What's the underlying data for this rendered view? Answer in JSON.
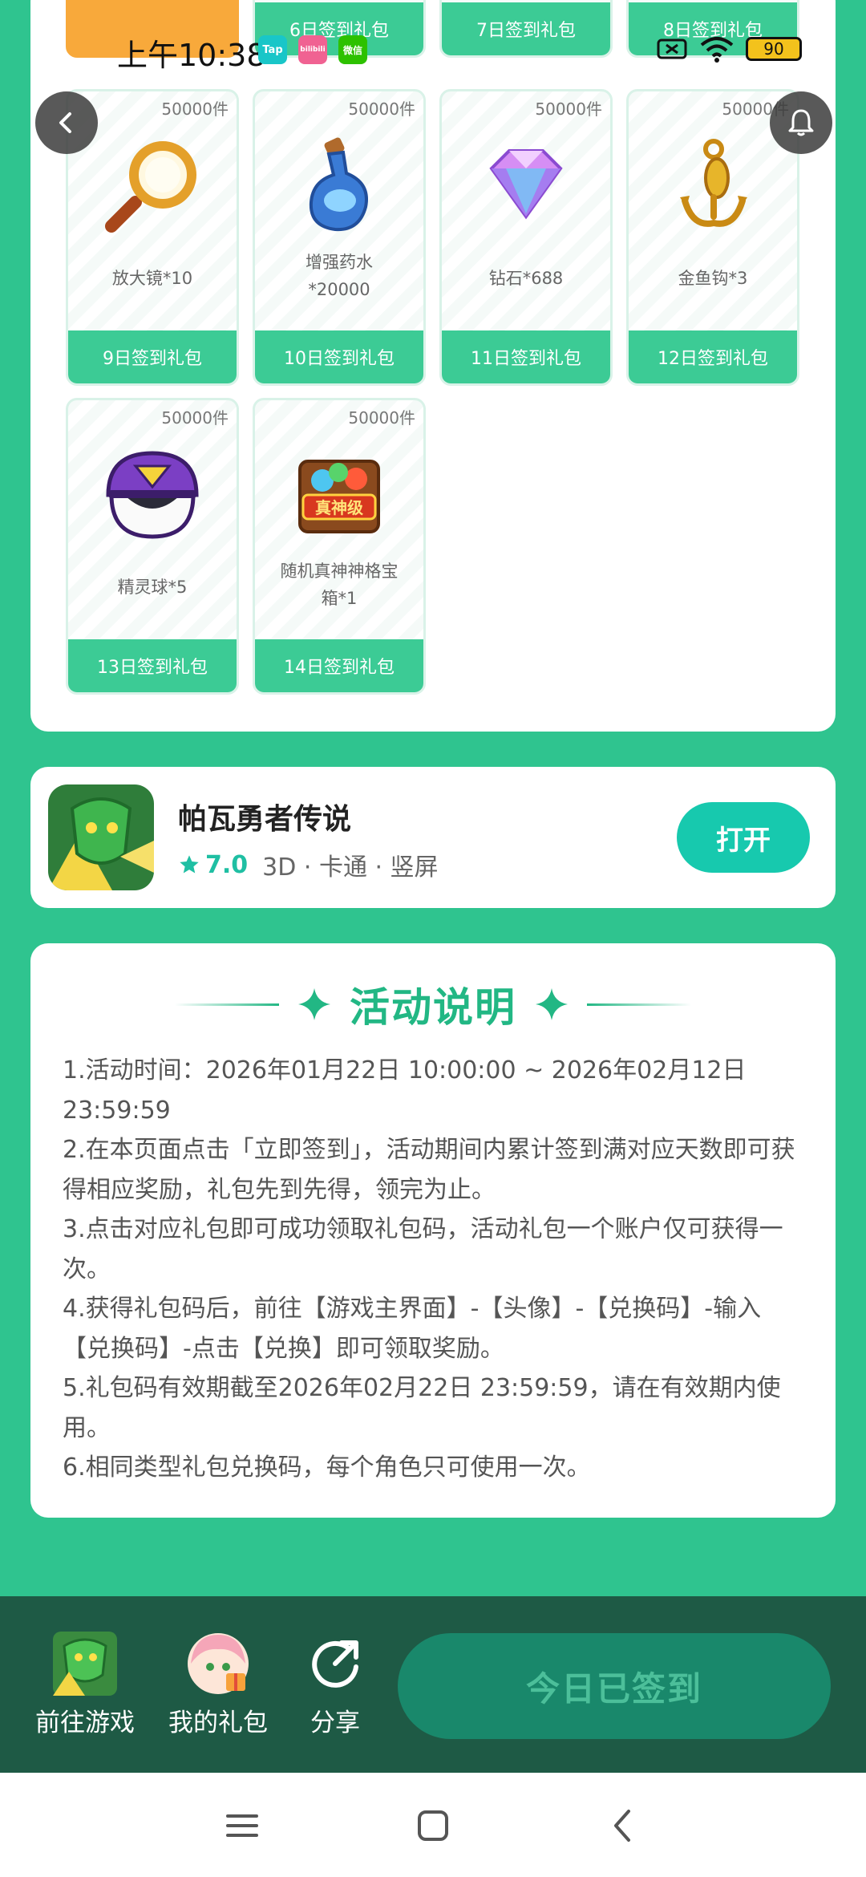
{
  "status_bar": {
    "time": "上午10:38",
    "apps": [
      "Tap",
      "bilibili",
      "微信"
    ],
    "battery": "90"
  },
  "gift_grid": {
    "top_row_labels": [
      "",
      "6日签到礼包",
      "7日签到礼包",
      "8日签到礼包"
    ],
    "items": [
      {
        "stock": "50000件",
        "name": "放大镜*10",
        "button": "9日签到礼包",
        "icon": "magnifier-icon"
      },
      {
        "stock": "50000件",
        "name": "增强药水\n*20000",
        "button": "10日签到礼包",
        "icon": "potion-icon"
      },
      {
        "stock": "50000件",
        "name": "钻石*688",
        "button": "11日签到礼包",
        "icon": "diamond-icon"
      },
      {
        "stock": "50000件",
        "name": "金鱼钩*3",
        "button": "12日签到礼包",
        "icon": "hook-icon"
      },
      {
        "stock": "50000件",
        "name": "精灵球*5",
        "button": "13日签到礼包",
        "icon": "spirit-ball-icon"
      },
      {
        "stock": "50000件",
        "name": "随机真神神格宝\n箱*1",
        "button": "14日签到礼包",
        "icon": "treasure-box-icon"
      }
    ],
    "box_badge": "真神级"
  },
  "game": {
    "title": "帕瓦勇者传说",
    "rating": "7.0",
    "tags": "3D · 卡通 · 竖屏",
    "open_label": "打开"
  },
  "rules": {
    "title": "活动说明",
    "lines": [
      "1.活动时间：2026年01月22日 10:00:00 ~ 2026年02月12日 23:59:59",
      "2.在本页面点击「立即签到」，活动期间内累计签到满对应天数即可获得相应奖励，礼包先到先得，领完为止。",
      "3.点击对应礼包即可成功领取礼包码，活动礼包一个账户仅可获得一次。",
      "4.获得礼包码后，前往【游戏主界面】-【头像】-【兑换码】-输入【兑换码】-点击【兑换】即可领取奖励。",
      "5.礼包码有效期截至2026年02月22日 23:59:59，请在有效期内使用。",
      "6.相同类型礼包兑换码，每个角色只可使用一次。"
    ]
  },
  "bottom_bar": {
    "go_game": "前往游戏",
    "my_gifts": "我的礼包",
    "share": "分享",
    "signed": "今日已签到"
  },
  "colors": {
    "background": "#2fc48f",
    "accent": "#3ccb95",
    "open_button": "#17c9ae",
    "bottom_bar": "#1e5a45"
  }
}
